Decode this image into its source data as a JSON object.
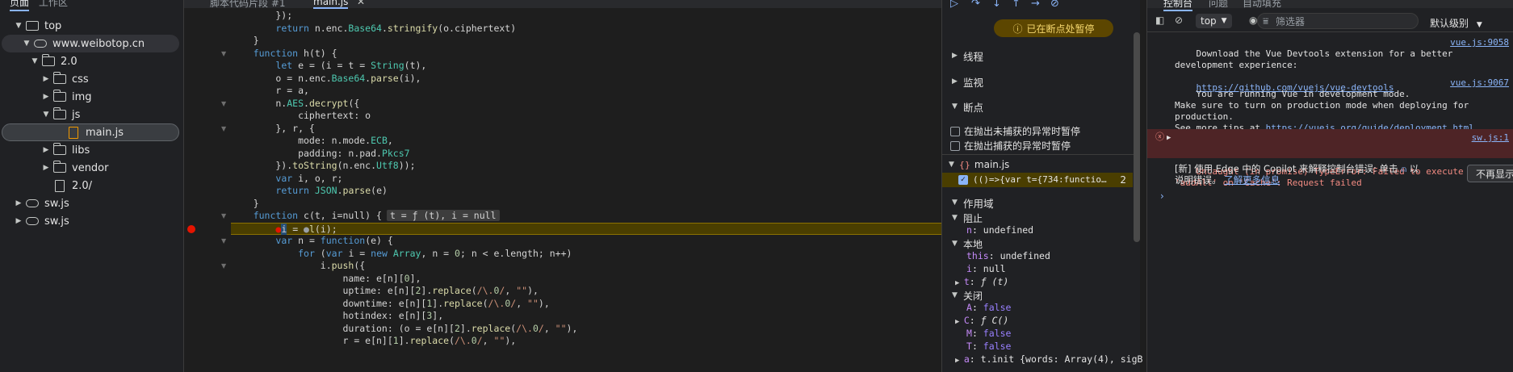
{
  "left_panel": {
    "tabs": [
      "页面",
      "工作区"
    ],
    "tree": [
      {
        "label": "top",
        "icon": "frame-icon",
        "expanded": true
      },
      {
        "label": "www.weibotop.cn",
        "icon": "cloud-icon",
        "expanded": true
      },
      {
        "label": "2.0",
        "icon": "folder-icon",
        "expanded": true
      },
      {
        "label": "css",
        "icon": "folder-icon",
        "expanded": false
      },
      {
        "label": "img",
        "icon": "folder-icon",
        "expanded": false
      },
      {
        "label": "js",
        "icon": "folder-icon",
        "expanded": true
      },
      {
        "label": "main.js",
        "icon": "file-icon",
        "selected": true
      },
      {
        "label": "libs",
        "icon": "folder-icon",
        "expanded": false
      },
      {
        "label": "vendor",
        "icon": "folder-icon",
        "expanded": false
      },
      {
        "label": "2.0/",
        "icon": "file-icon"
      },
      {
        "label": "sw.js",
        "icon": "cloud-icon",
        "expanded": false
      },
      {
        "label": "sw.js",
        "icon": "cloud-icon",
        "expanded": false
      }
    ]
  },
  "editor": {
    "tabs": [
      "脚本代码片段 #1",
      "main.js"
    ],
    "active_tab": "main.js",
    "inline_value": "t = ƒ (t), i = null",
    "lines": [
      "        });",
      "        return n.enc.Base64.stringify(o.ciphertext)",
      "    }",
      "    function h(t) {",
      "        let e = (i = t = String(t),",
      "        o = n.enc.Base64.parse(i),",
      "        r = a,",
      "        n.AES.decrypt({",
      "            ciphertext: o",
      "        }, r, {",
      "            mode: n.mode.ECB,",
      "            padding: n.pad.Pkcs7",
      "        }).toString(n.enc.Utf8));",
      "        var i, o, r;",
      "        return JSON.parse(e)",
      "    }",
      "    function c(t, i=null) {",
      "        ●i = ●l(i);",
      "        var n = function(e) {",
      "            for (var i = new Array, n = 0; n < e.length; n++)",
      "                i.push({",
      "                    name: e[n][0],",
      "                    uptime: e[n][2].replace(/\\.0/, \"\"),",
      "                    downtime: e[n][1].replace(/\\.0/, \"\"),",
      "                    hotindex: e[n][3],",
      "                    duration: (o = e[n][2].replace(/\\.0/, \"\"),",
      "                    r = e[n][1].replace(/\\.0/, \"\"),"
    ]
  },
  "debugger": {
    "paused_label": "已在断点处暂停",
    "sections": {
      "threads": "线程",
      "watch": "监视",
      "breakpoints": "断点",
      "scope": "作用域"
    },
    "pause_uncaught": "在抛出未捕获的异常时暂停",
    "pause_caught": "在抛出捕获的异常时暂停",
    "bp_file": "main.js",
    "bp_code": "(()=>{var t={734:functio…",
    "bp_line": "2",
    "scope": {
      "block_label": "阻止",
      "block_vars": [
        {
          "k": "n",
          "v": "undefined"
        }
      ],
      "local_label": "本地",
      "local_vars": [
        {
          "k": "this",
          "v": "undefined"
        },
        {
          "k": "i",
          "v": "null"
        },
        {
          "k": "t",
          "v": "ƒ (t)"
        }
      ],
      "closure_label": "关闭",
      "closure_vars": [
        {
          "k": "A",
          "v": "false"
        },
        {
          "k": "C",
          "v": "ƒ C()"
        },
        {
          "k": "M",
          "v": "false"
        },
        {
          "k": "T",
          "v": "false"
        },
        {
          "k": "a",
          "v": "t.init {words: Array(4), sigB"
        }
      ]
    }
  },
  "console": {
    "tabs": [
      "控制台",
      "问题",
      "自动填充"
    ],
    "context": "top",
    "filter_placeholder": "筛选器",
    "levels": "默认级别",
    "messages": [
      {
        "text": "Download the Vue Devtools extension for a better\ndevelopment experience:",
        "link": "https://github.com/vuejs/vue-devtools",
        "src": "vue.js:9058"
      },
      {
        "text": "You are running Vue in development mode.\nMake sure to turn on production mode when deploying for\nproduction.\nSee more tips at ",
        "link": "https://vuejs.org/guide/deployment.html",
        "src": "vue.js:9067"
      }
    ],
    "error": {
      "text": "Uncaught (in promise) TypeError: Failed to execute\n'addAll' on 'Cache': Request failed",
      "src": "sw.js:1"
    },
    "copilot_text_1": "[新] 使用 Edge 中的 Copilot 来解释控制台错误: 单击",
    "copilot_text_2": "以",
    "copilot_text_3": "说明错误。",
    "copilot_link": "了解更多信息",
    "dismiss": "不再显示"
  },
  "colors": {
    "paused_line": "#4a3e00",
    "error_bg": "#4e2426",
    "accent": "#8ab4f8"
  }
}
